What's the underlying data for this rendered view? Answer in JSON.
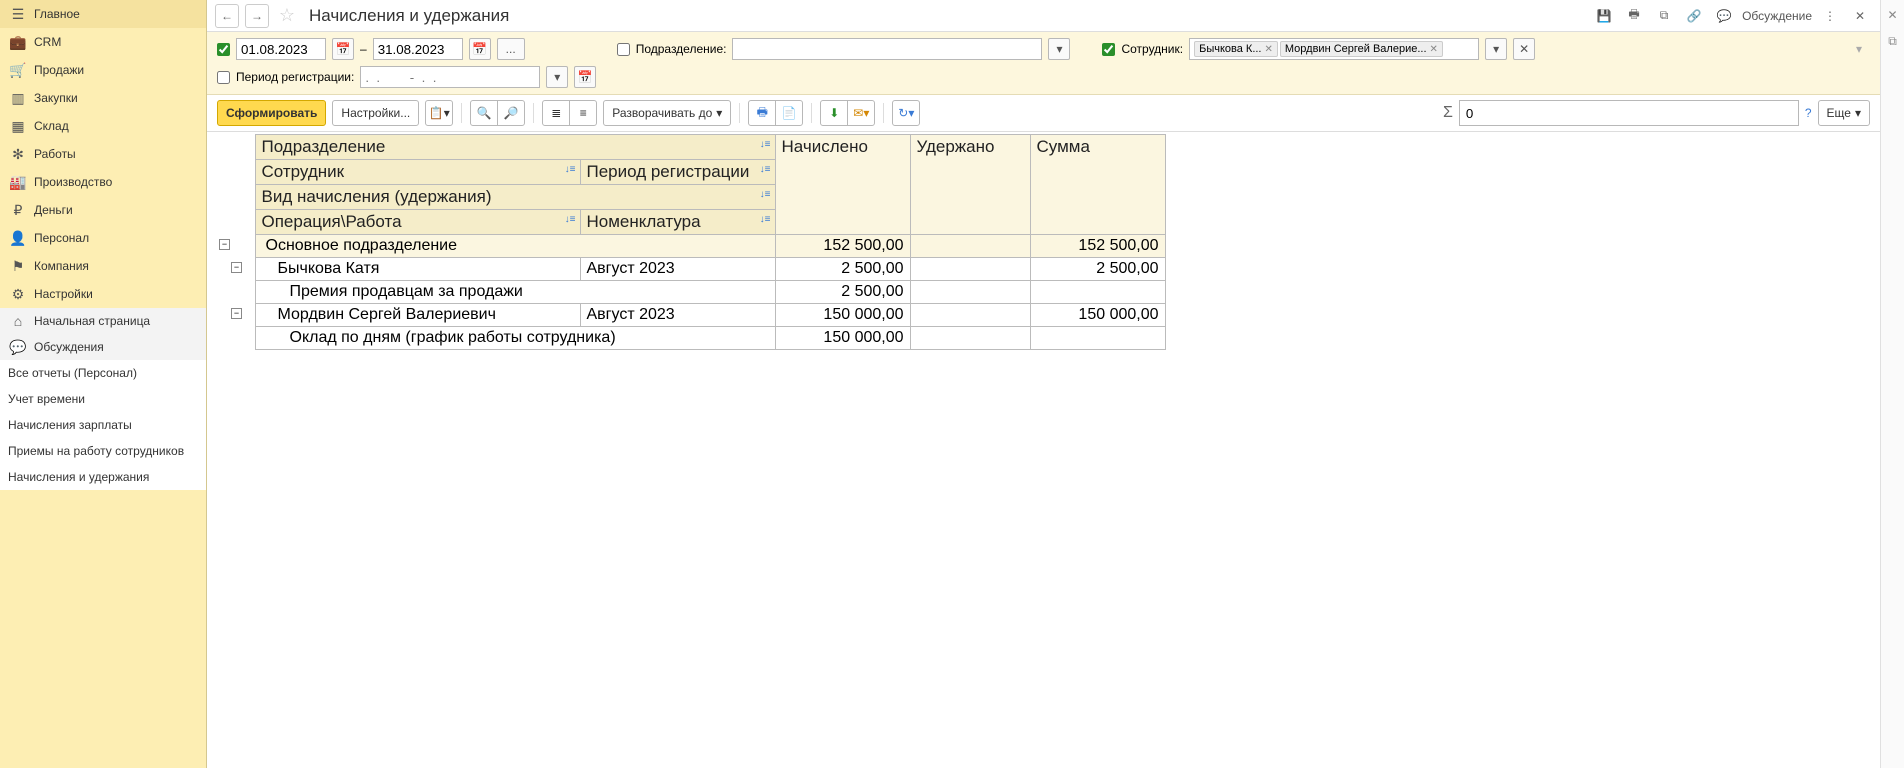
{
  "sidebar": {
    "main_items": [
      {
        "label": "Главное",
        "icon": "menu"
      },
      {
        "label": "CRM",
        "icon": "briefcase"
      },
      {
        "label": "Продажи",
        "icon": "cart"
      },
      {
        "label": "Закупки",
        "icon": "barcode"
      },
      {
        "label": "Склад",
        "icon": "boxes"
      },
      {
        "label": "Работы",
        "icon": "tools"
      },
      {
        "label": "Производство",
        "icon": "factory"
      },
      {
        "label": "Деньги",
        "icon": "coin"
      },
      {
        "label": "Персонал",
        "icon": "person"
      },
      {
        "label": "Компания",
        "icon": "flag"
      },
      {
        "label": "Настройки",
        "icon": "gear"
      }
    ],
    "extra_items": [
      {
        "label": "Начальная страница",
        "icon": "home"
      },
      {
        "label": "Обсуждения",
        "icon": "chat"
      }
    ],
    "sub_items": [
      "Все отчеты (Персонал)",
      "Учет времени",
      "Начисления зарплаты",
      "Приемы на работу сотрудников",
      "Начисления и удержания"
    ]
  },
  "header": {
    "title": "Начисления и удержания",
    "discuss": "Обсуждение"
  },
  "filter": {
    "date_from": "01.08.2023",
    "date_to": "31.08.2023",
    "dash": "–",
    "ellipsis": "...",
    "dept_label": "Подразделение:",
    "emp_label": "Сотрудник:",
    "chips": [
      "Бычкова К...",
      "Мордвин Сергей Валерие..."
    ],
    "period_reg_label": "Период регистрации:",
    "period_placeholder": ".  .        -  .  ."
  },
  "toolbar": {
    "generate": "Сформировать",
    "settings": "Настройки...",
    "expand": "Разворачивать до",
    "sum_value": "0",
    "more": "Еще",
    "sigma": "Σ"
  },
  "report": {
    "headers": {
      "dept": "Подразделение",
      "emp": "Сотрудник",
      "period": "Период регистрации",
      "type": "Вид начисления (удержания)",
      "op": "Операция\\Работа",
      "nom": "Номенклатура",
      "accrued": "Начислено",
      "withheld": "Удержано",
      "total": "Сумма"
    },
    "rows": [
      {
        "level": 1,
        "c1": "Основное подразделение",
        "c2": "",
        "accrued": "152 500,00",
        "withheld": "",
        "total": "152 500,00"
      },
      {
        "level": 2,
        "c1": "Бычкова Катя",
        "c2": "Август 2023",
        "accrued": "2 500,00",
        "withheld": "",
        "total": "2 500,00"
      },
      {
        "level": 3,
        "c1": "Премия продавцам за продажи",
        "c2": "",
        "accrued": "2 500,00",
        "withheld": "",
        "total": ""
      },
      {
        "level": 2,
        "c1": "Мордвин Сергей Валериевич",
        "c2": "Август 2023",
        "accrued": "150 000,00",
        "withheld": "",
        "total": "150 000,00"
      },
      {
        "level": 3,
        "c1": "Оклад по дням (график работы сотрудника)",
        "c2": "",
        "accrued": "150 000,00",
        "withheld": "",
        "total": ""
      }
    ]
  }
}
